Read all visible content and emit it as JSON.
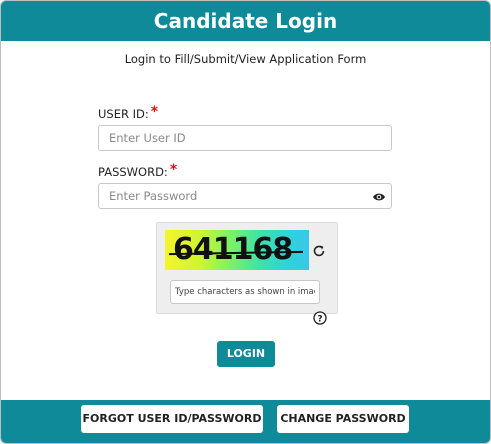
{
  "header": {
    "title": "Candidate Login"
  },
  "subtitle": "Login to Fill/Submit/View Application Form",
  "user_id": {
    "label": "USER ID:",
    "required_mark": "*",
    "placeholder": "Enter User ID",
    "value": ""
  },
  "password": {
    "label": "PASSWORD:",
    "required_mark": "*",
    "placeholder": "Enter Password",
    "value": ""
  },
  "captcha": {
    "text": "641168",
    "input_placeholder": "Type characters as shown in image"
  },
  "buttons": {
    "login": "LOGIN",
    "forgot": "FORGOT USER ID/PASSWORD",
    "change_password": "CHANGE PASSWORD"
  },
  "icons": {
    "show_password": "eye-icon",
    "refresh_captcha": "refresh-icon",
    "help": "question-circle-icon"
  },
  "colors": {
    "accent": "#0e8a99",
    "required": "#dd1111"
  }
}
